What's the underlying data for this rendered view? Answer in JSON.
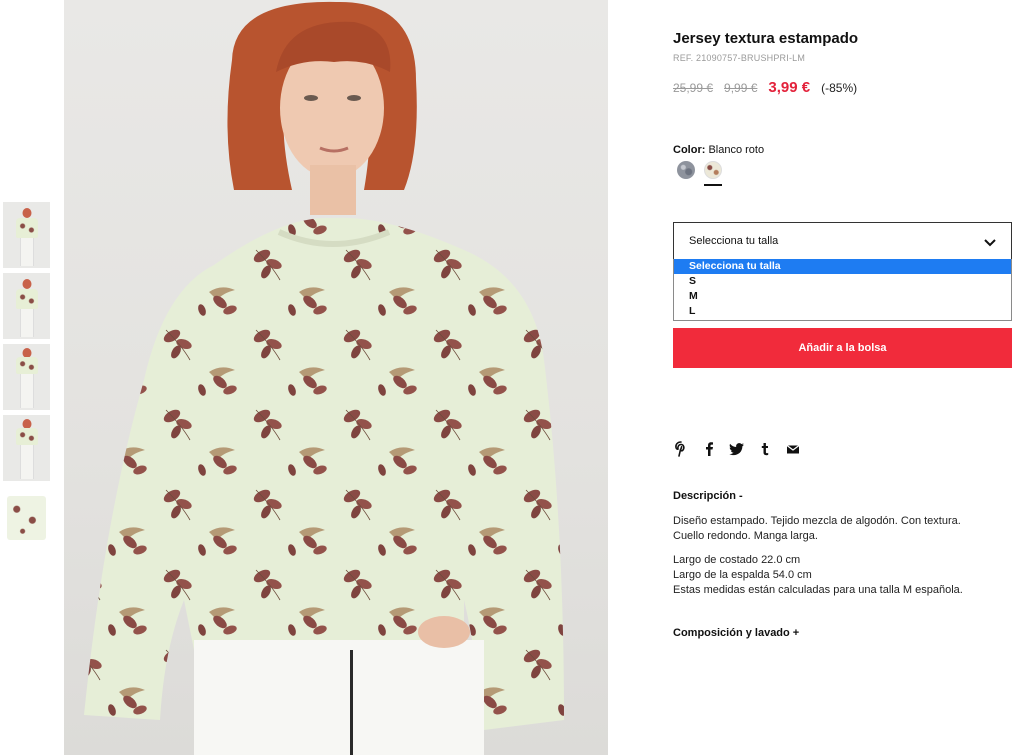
{
  "product": {
    "title": "Jersey textura estampado",
    "ref": "REF. 21090757-BRUSHPRI-LM",
    "price_original": "25,99 €",
    "price_previous": "9,99 €",
    "price_current": "3,99 €",
    "discount": "(-85%)"
  },
  "color": {
    "label": "Color:",
    "value": "Blanco roto",
    "swatches": [
      "grey-print-swatch",
      "offwhite-floral-swatch"
    ],
    "selected_index": 1
  },
  "size": {
    "placeholder": "Selecciona tu talla",
    "options": [
      "Selecciona tu talla",
      "S",
      "M",
      "L"
    ],
    "selected_index": 0
  },
  "add_to_bag": "Añadir a la bolsa",
  "share_icons": [
    "pinterest-icon",
    "facebook-icon",
    "twitter-icon",
    "tumblr-icon",
    "email-icon"
  ],
  "description": {
    "heading": "Descripción -",
    "text1": "Diseño estampado. Tejido mezcla de algodón. Con textura.",
    "text1b": "Cuello redondo. Manga larga.",
    "text2": "Largo de costado 22.0 cm",
    "text3": "Largo de la espalda 54.0 cm",
    "text4": "Estas medidas están calculadas para una talla M española."
  },
  "composition_heading": "Composición y lavado +",
  "thumbnails": [
    "front-view",
    "side-view",
    "full-body-view",
    "full-body-side-view",
    "flat-garment-view"
  ],
  "colors": {
    "accent": "#f12b3b",
    "price_red": "#e3223b",
    "select_highlight": "#1e7cf2"
  }
}
